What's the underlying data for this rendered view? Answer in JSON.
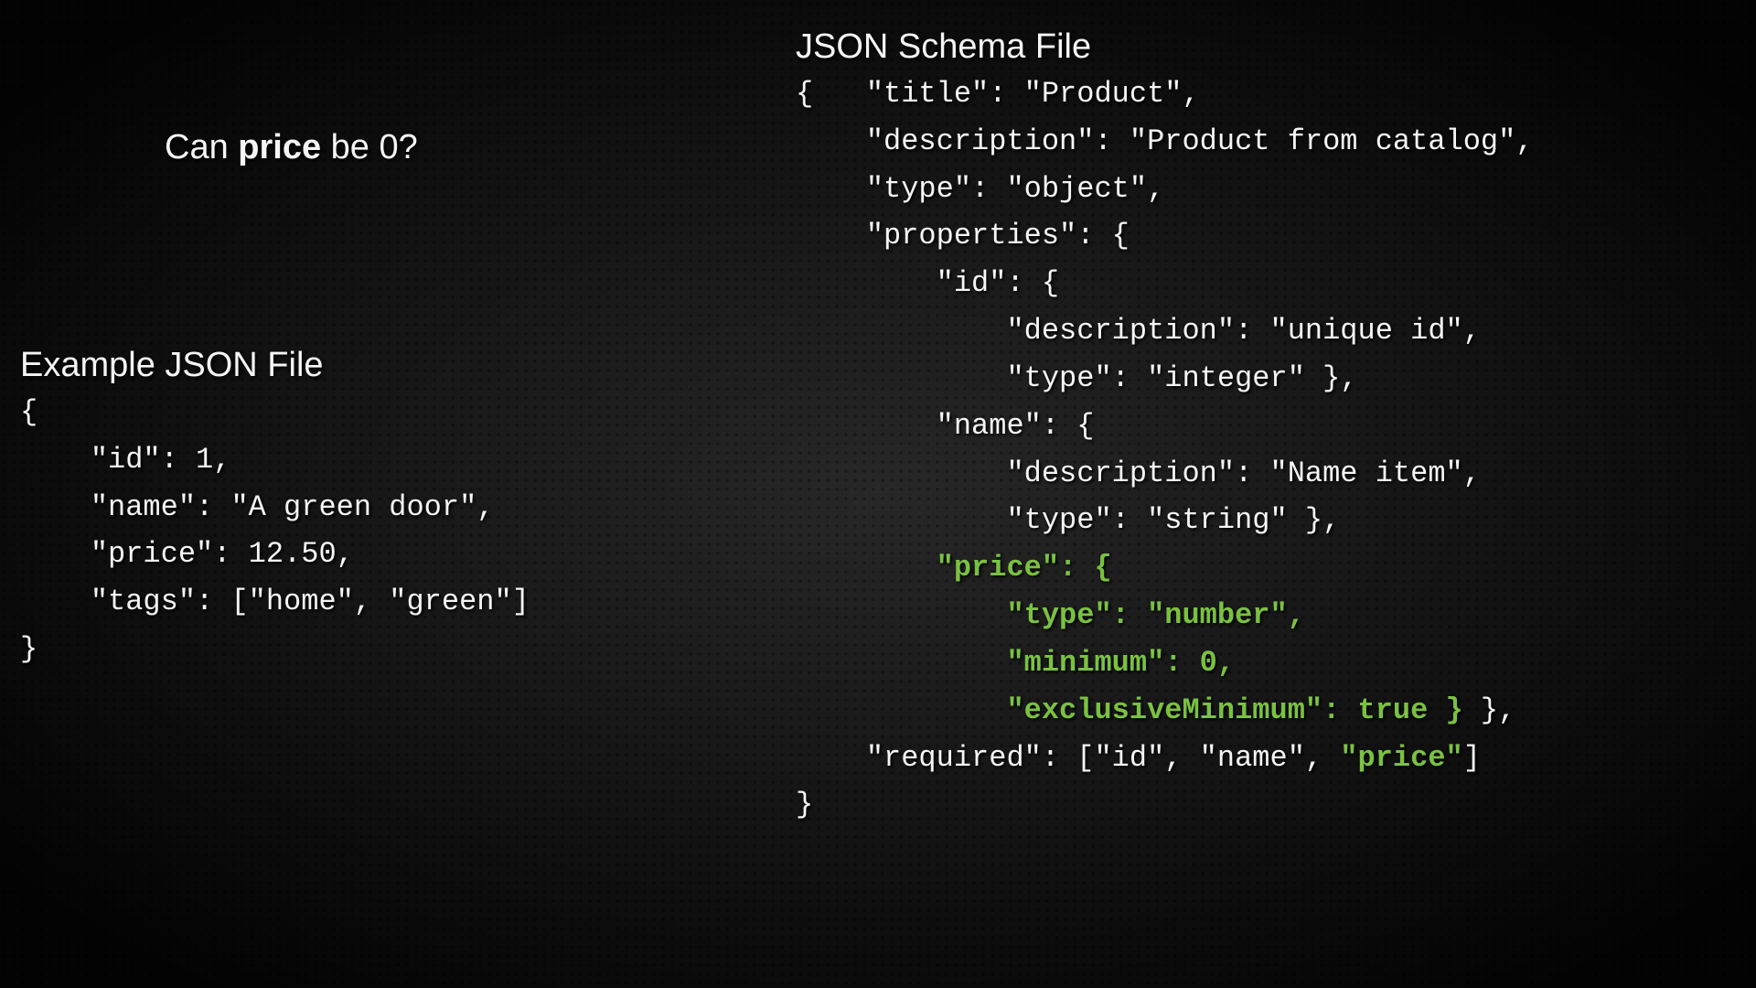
{
  "question": {
    "prefix": "Can ",
    "emph": "price",
    "suffix": " be 0?"
  },
  "example": {
    "title": "Example JSON File",
    "lines": {
      "l0": "{",
      "l1": "    \"id\": 1,",
      "l2": "    \"name\": \"A green door\",",
      "l3": "    \"price\": 12.50,",
      "l4": "    \"tags\": [\"home\", \"green\"]",
      "l5": "}"
    }
  },
  "schema": {
    "title": "JSON Schema File",
    "lines": {
      "l0": "{   \"title\": \"Product\",",
      "l1": "    \"description\": \"Product from catalog\",",
      "l2": "    \"type\": \"object\",",
      "l3": "    \"properties\": {",
      "l4": "        \"id\": {",
      "l5": "            \"description\": \"unique id\",",
      "l6": "            \"type\": \"integer\" },",
      "l7": "        \"name\": {",
      "l8": "            \"description\": \"Name item\",",
      "l9": "            \"type\": \"string\" },",
      "l10a": "        ",
      "l10b": "\"price\": {",
      "l11a": "            ",
      "l11b": "\"type\": \"number\",",
      "l12a": "            ",
      "l12b": "\"minimum\": 0,",
      "l13a": "            ",
      "l13b": "\"exclusiveMinimum\": true }",
      "l13c": " },",
      "l14a": "    \"required\": [\"id\", \"name\", ",
      "l14b": "\"price\"",
      "l14c": "]",
      "l15": "}"
    }
  }
}
